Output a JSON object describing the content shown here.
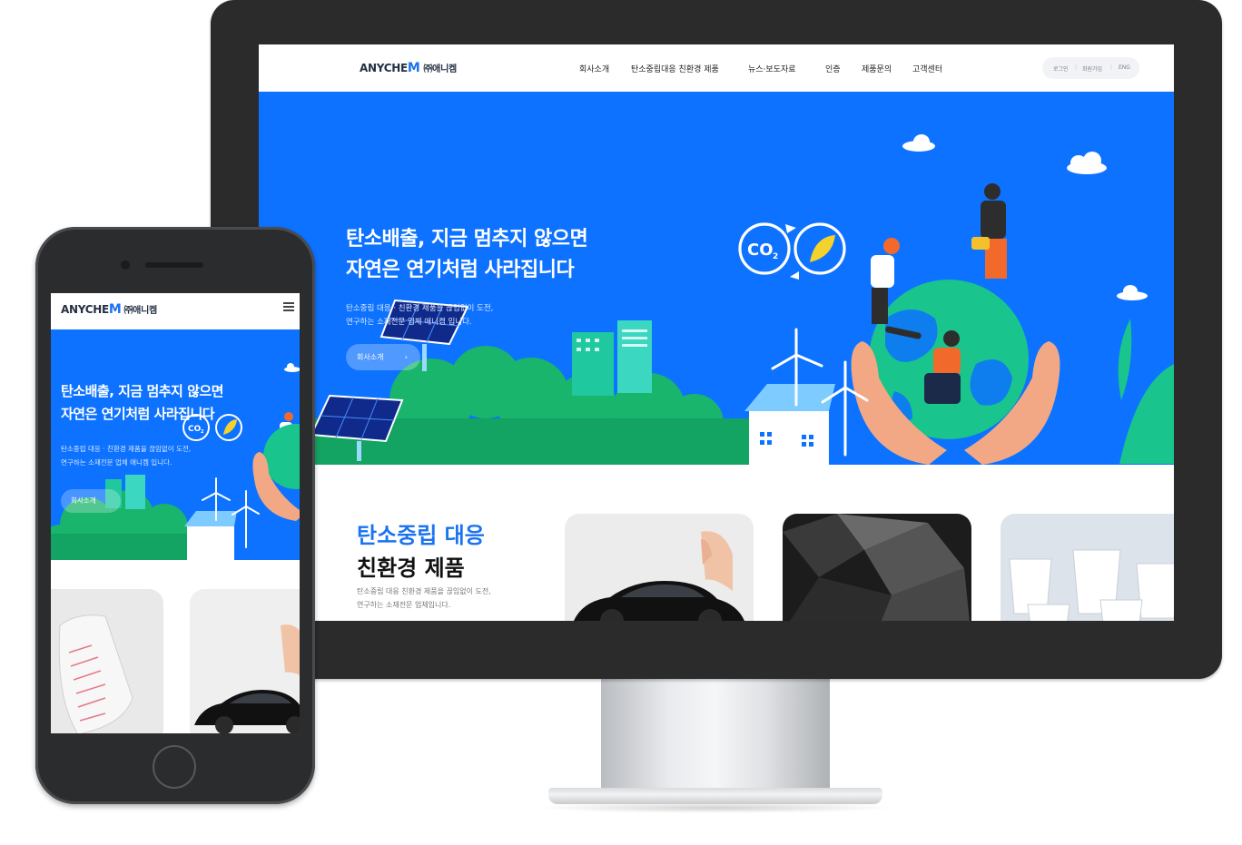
{
  "desktop": {
    "logo": {
      "brand": "ANYCHE",
      "brand_mark": "M",
      "company": "㈜애니켐"
    },
    "nav": [
      "회사소개",
      "탄소중립대응 친환경 제품",
      "뉴스·보도자료",
      "인증",
      "제품문의",
      "고객센터"
    ],
    "util": [
      "로그인",
      "회원가입",
      "ENG"
    ],
    "hero": {
      "title_line1": "탄소배출, 지금 멈추지 않으면",
      "title_line2": "자연은 연기처럼 사라집니다",
      "sub_line1": "탄소중립 대응 · 친환경 제품을 끊임없이 도전,",
      "sub_line2": "연구하는 소재전문 업체 애니켐 입니다.",
      "button": "회사소개",
      "co2_label": "CO",
      "co2_sub": "2"
    },
    "products": {
      "title_line1": "탄소중립 대응",
      "title_line2": "친환경 제품",
      "sub_line1": "탄소중립 대응 친환경 제품을 끊임없이 도전,",
      "sub_line2": "연구하는 소재전문 업체입니다."
    }
  },
  "mobile": {
    "logo": {
      "brand": "ANYCHE",
      "brand_mark": "M",
      "company": "㈜애니켐"
    },
    "hero": {
      "title_line1": "탄소배출, 지금 멈추지 않으면",
      "title_line2": "자연은 연기처럼 사라집니다",
      "sub_line1": "탄소중립 대응 · 친환경 제품을 끊임없이 도전,",
      "sub_line2": "연구하는 소재전문 업체 애니켐 입니다.",
      "button": "회사소개",
      "co2_label": "CO",
      "co2_sub": "2"
    }
  },
  "colors": {
    "brand_blue": "#0d72ff",
    "accent_blue": "#1a73f0",
    "device_dark": "#2b2b2c"
  }
}
